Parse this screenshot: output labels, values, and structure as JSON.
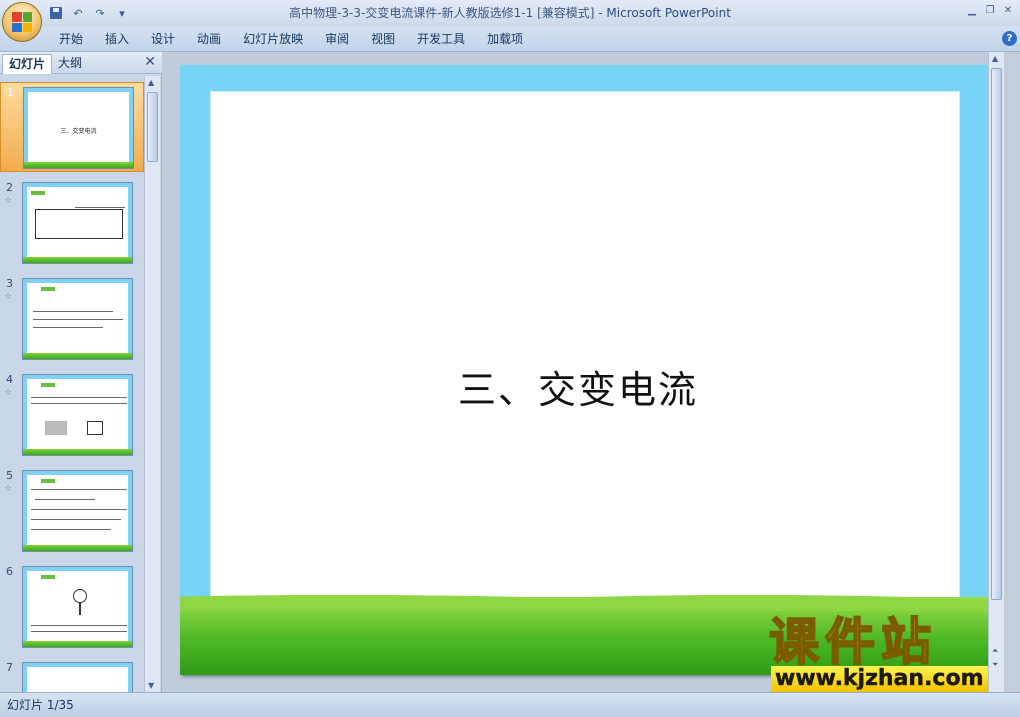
{
  "window": {
    "title": "高中物理-3-3-交变电流课件-新人教版选修1-1 [兼容模式]",
    "app_name": "- Microsoft PowerPoint"
  },
  "quick_access": {
    "save_icon": "save-icon",
    "undo_icon": "undo-icon",
    "redo_icon": "redo-icon",
    "customize_icon": "qat-dropdown-icon"
  },
  "ribbon": {
    "tabs": [
      "开始",
      "插入",
      "设计",
      "动画",
      "幻灯片放映",
      "审阅",
      "视图",
      "开发工具",
      "加载项"
    ],
    "help_label": "?"
  },
  "panel": {
    "tab_slides": "幻灯片",
    "tab_outline": "大纲",
    "close_label": "✕",
    "thumbnails": [
      {
        "number": "1",
        "title": "三、交变电流",
        "selected": true
      },
      {
        "number": "2",
        "has_animation": true
      },
      {
        "number": "3",
        "has_animation": true
      },
      {
        "number": "4",
        "has_animation": true
      },
      {
        "number": "5",
        "has_animation": true
      },
      {
        "number": "6",
        "has_animation": true
      },
      {
        "number": "7"
      }
    ],
    "animation_marker": "☆"
  },
  "slide": {
    "title": "三、交变电流"
  },
  "statusbar": {
    "slide_counter": "幻灯片 1/35"
  },
  "watermark": {
    "text_cn": "课件站",
    "url": "www.kjzhan.com"
  },
  "colors": {
    "slide_frame": "#76d4f6",
    "grass": "#4cb824",
    "selected_thumb": "#f4ab4e",
    "watermark_yellow": "#f1d312"
  }
}
